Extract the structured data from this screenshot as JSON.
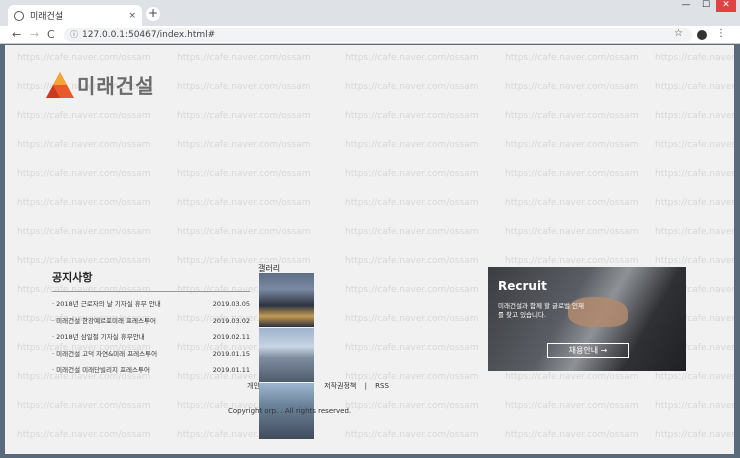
{
  "browser": {
    "tab_title": "미래건설",
    "tab_close": "×",
    "new_tab": "+",
    "url": "127.0.0.1:50467/index.html#",
    "nav_back": "←",
    "nav_forward": "→",
    "nav_reload": "C",
    "bookmark": "☆",
    "menu": "⋮",
    "win_min": "—",
    "win_max": "☐",
    "win_close": "✕"
  },
  "logo": {
    "text": "미래건설",
    "accent": "#e85a2c"
  },
  "watermark": "https://cafe.naver.com/ossam",
  "notice": {
    "title": "공지사항",
    "items": [
      {
        "title": "· 2018년 근로자의 날 기자실 휴무 안내",
        "date": "2019.03.05"
      },
      {
        "title": "· 미래건설 한강예르포미래 프레스투어",
        "date": "2019.03.02"
      },
      {
        "title": "· 2018년 삼일절 기자실 휴무안내",
        "date": "2019.02.11"
      },
      {
        "title": "· 미래건설 고덕 자연&미래 프레스투어",
        "date": "2019.01.15"
      },
      {
        "title": "· 미래건설 미래단빌리지 프레스투어",
        "date": "2019.01.11"
      }
    ]
  },
  "gallery": {
    "title": "갤러리"
  },
  "footer": {
    "links": [
      "개인",
      "저작권정책",
      "|",
      "RSS"
    ],
    "copyright": "Copyright                      orp. . All rights reserved."
  },
  "recruit": {
    "title": "Recruit",
    "text": "미래건설과 함께 할 글로벌 인재를 찾고 있습니다.",
    "button": "채용안내  →"
  }
}
